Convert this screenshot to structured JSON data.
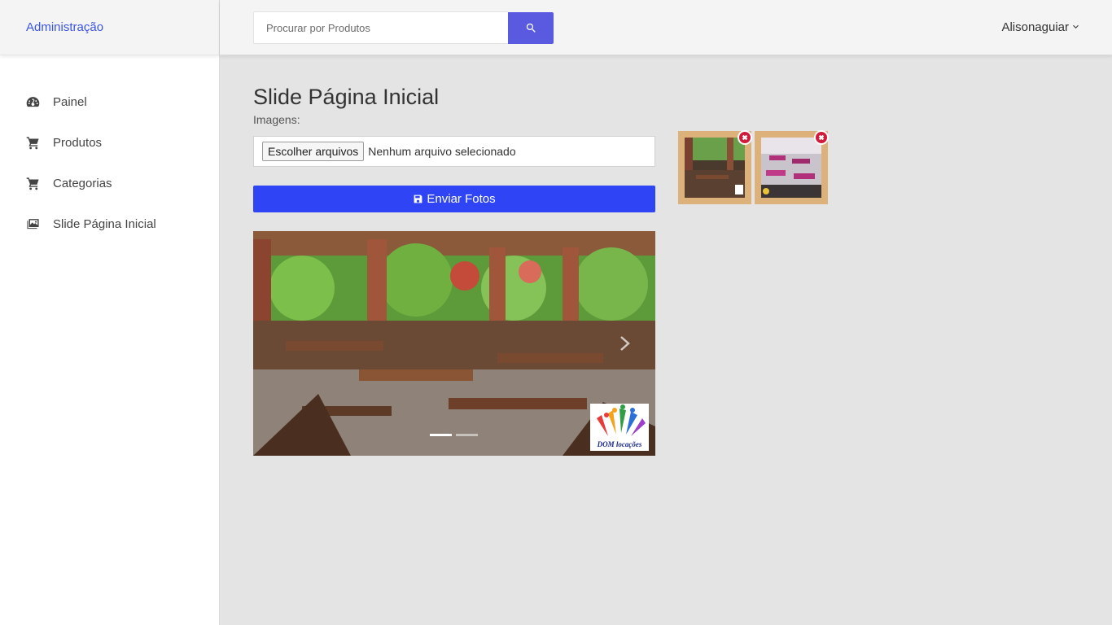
{
  "sidebar": {
    "brand": "Administração",
    "items": [
      {
        "label": "Painel",
        "icon": "dashboard-icon"
      },
      {
        "label": "Produtos",
        "icon": "cart-icon"
      },
      {
        "label": "Categorias",
        "icon": "cart-icon"
      },
      {
        "label": "Slide Página Inicial",
        "icon": "images-icon"
      }
    ]
  },
  "header": {
    "search_placeholder": "Procurar por Produtos",
    "user_name": "Alisonaguiar"
  },
  "main": {
    "title": "Slide Página Inicial",
    "images_label": "Imagens:",
    "file_button": "Escolher arquivos",
    "file_status": "Nenhum arquivo selecionado",
    "send_button": "Enviar Fotos",
    "slideshow": {
      "logo_text": "DOM locações",
      "slide_count": 2,
      "active_index": 0
    },
    "thumbnails": [
      {
        "name": "thumbnail-1"
      },
      {
        "name": "thumbnail-2"
      }
    ]
  },
  "colors": {
    "brand": "#3b55e6",
    "primary_button": "#2f45f5",
    "search_button": "#5a5ae0",
    "delete_badge": "#d21a3a",
    "thumb_frame": "#dcb27a"
  }
}
